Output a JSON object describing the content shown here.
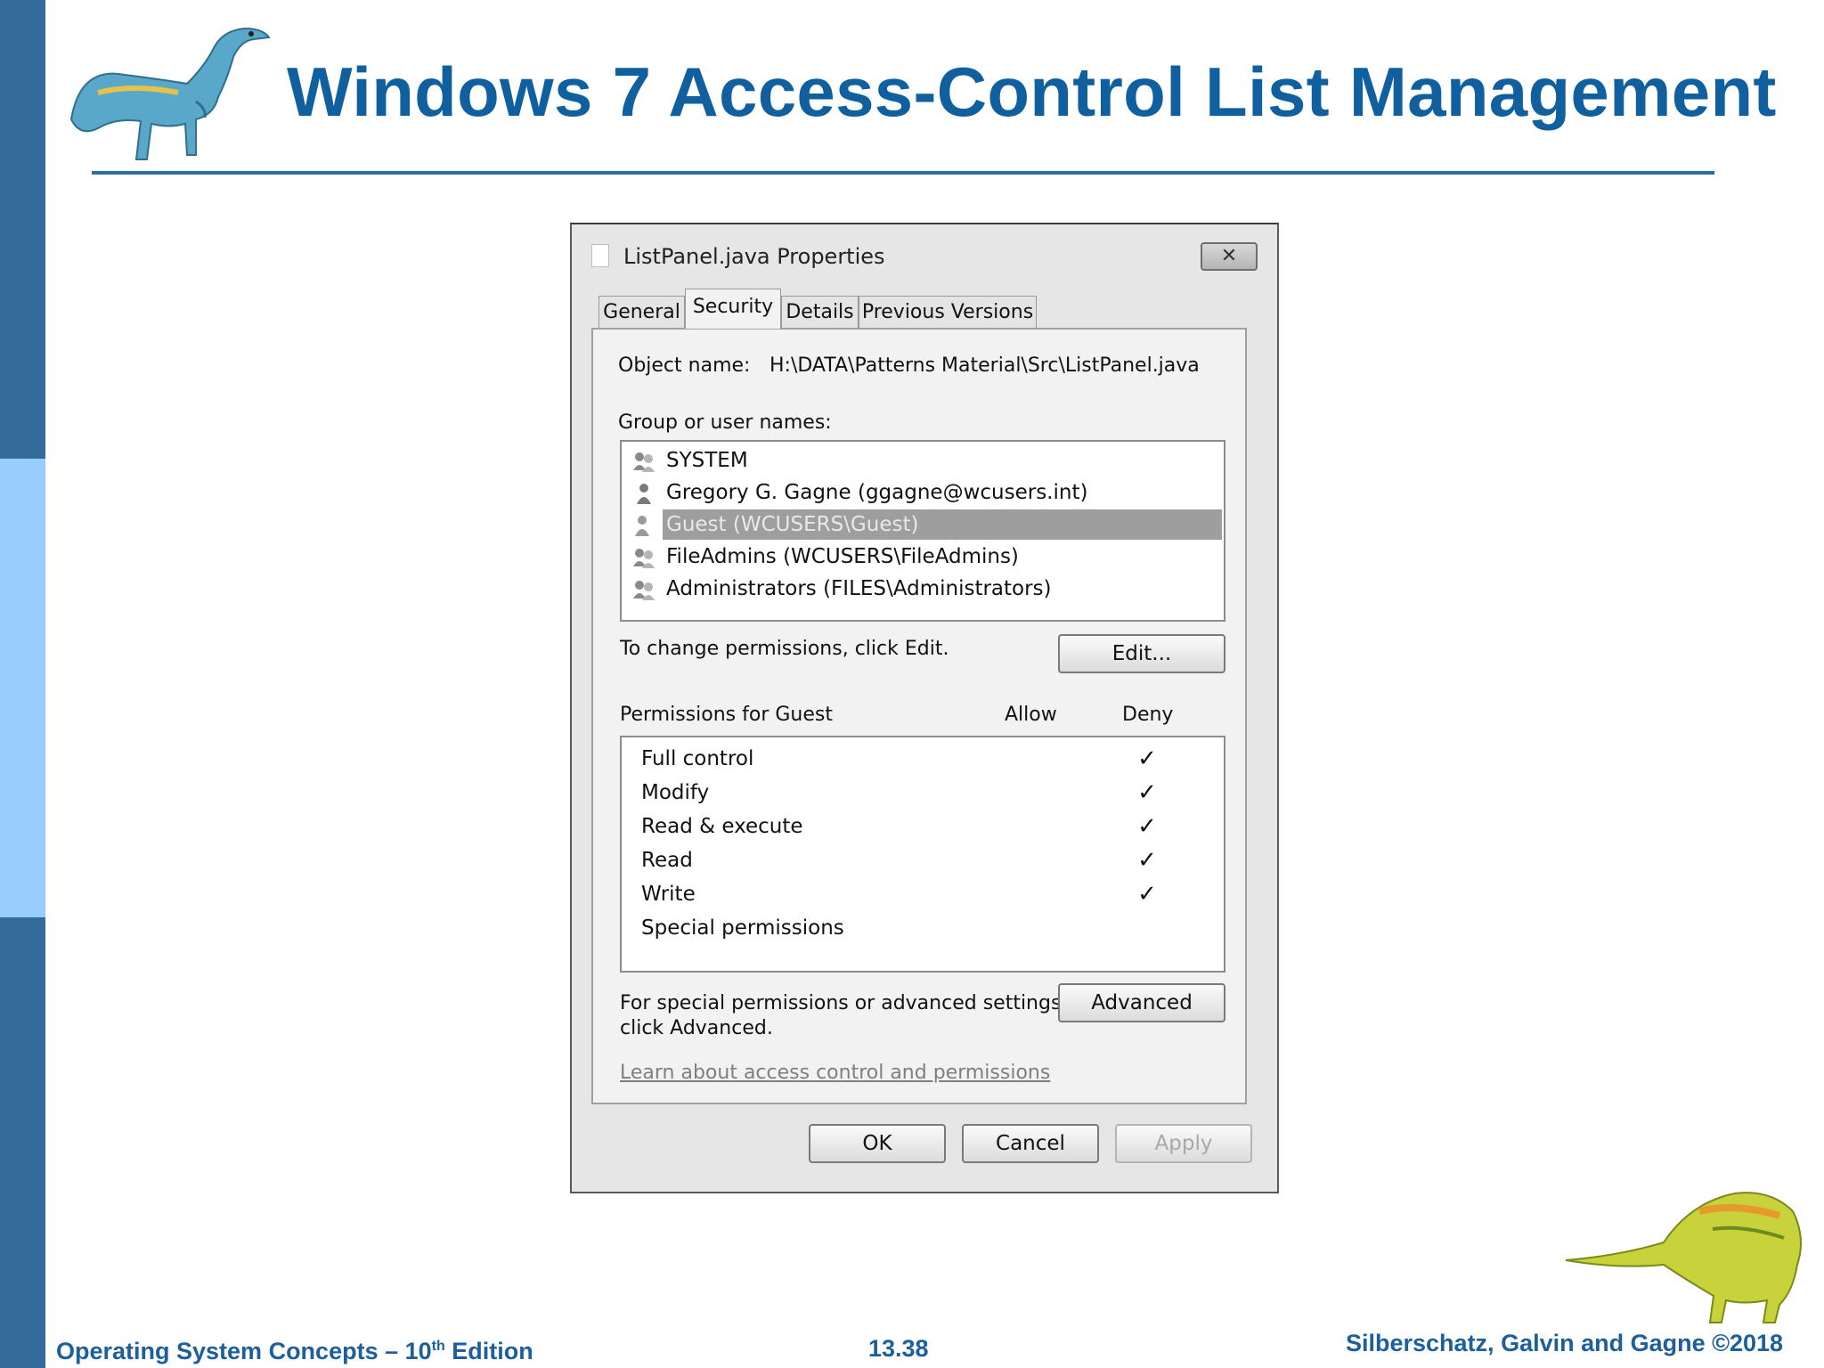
{
  "slide": {
    "title": "Windows 7 Access-Control List Management",
    "footer_left": "Operating System Concepts – 10",
    "footer_left_sup": "th",
    "footer_left_suffix": " Edition",
    "page_number": "13.38",
    "footer_right": "Silberschatz, Galvin and Gagne ©2018"
  },
  "dialog": {
    "title": "ListPanel.java Properties",
    "close_symbol": "✕",
    "tabs": [
      {
        "label": "General",
        "active": false
      },
      {
        "label": "Security",
        "active": true
      },
      {
        "label": "Details",
        "active": false
      },
      {
        "label": "Previous Versions",
        "active": false
      }
    ],
    "object_name_label": "Object name:",
    "object_name_value": "H:\\DATA\\Patterns Material\\Src\\ListPanel.java",
    "group_label": "Group or user names:",
    "users": [
      {
        "name": "SYSTEM",
        "icon": "group-icon",
        "selected": false
      },
      {
        "name": "Gregory G. Gagne (ggagne@wcusers.int)",
        "icon": "user-icon",
        "selected": false
      },
      {
        "name": "Guest (WCUSERS\\Guest)",
        "icon": "user-icon",
        "selected": true
      },
      {
        "name": "FileAdmins (WCUSERS\\FileAdmins)",
        "icon": "group-icon",
        "selected": false
      },
      {
        "name": "Administrators (FILES\\Administrators)",
        "icon": "group-icon",
        "selected": false
      }
    ],
    "change_hint": "To change permissions, click Edit.",
    "edit_button": "Edit...",
    "permissions_label": "Permissions for Guest",
    "allow_header": "Allow",
    "deny_header": "Deny",
    "permissions": [
      {
        "name": "Full control",
        "allow": "",
        "deny": "✓"
      },
      {
        "name": "Modify",
        "allow": "",
        "deny": "✓"
      },
      {
        "name": "Read & execute",
        "allow": "",
        "deny": "✓"
      },
      {
        "name": "Read",
        "allow": "",
        "deny": "✓"
      },
      {
        "name": "Write",
        "allow": "",
        "deny": "✓"
      },
      {
        "name": "Special permissions",
        "allow": "",
        "deny": ""
      }
    ],
    "advanced_hint_line1": "For special permissions or advanced settings,",
    "advanced_hint_line2": "click Advanced.",
    "advanced_button": "Advanced",
    "learn_link": "Learn about access control and permissions",
    "ok_button": "OK",
    "cancel_button": "Cancel",
    "apply_button": "Apply"
  }
}
